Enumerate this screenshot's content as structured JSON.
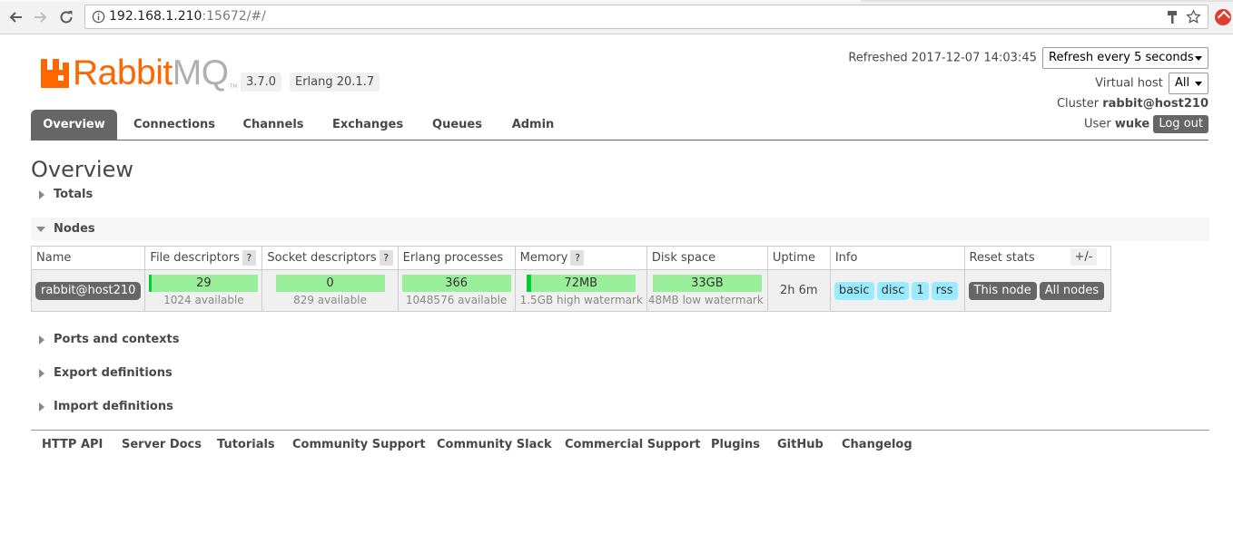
{
  "browser": {
    "url_host": "192.168.1.210",
    "url_rest": ":15672/#/"
  },
  "header": {
    "logo_primary": "Rabbit",
    "logo_secondary": "MQ",
    "logo_tm": "TM",
    "version": "3.7.0",
    "erlang": "Erlang 20.1.7",
    "refreshed_label": "Refreshed 2017-12-07 14:03:45",
    "refresh_select": "Refresh every 5 seconds",
    "vhost_label": "Virtual host",
    "vhost_select": "All",
    "cluster_label": "Cluster",
    "cluster_value": "rabbit@host210",
    "user_label": "User",
    "user_value": "wuke",
    "logout_label": "Log out"
  },
  "tabs": [
    "Overview",
    "Connections",
    "Channels",
    "Exchanges",
    "Queues",
    "Admin"
  ],
  "page_title": "Overview",
  "sections": {
    "totals": "Totals",
    "nodes": "Nodes",
    "ports": "Ports and contexts",
    "export": "Export definitions",
    "import": "Import definitions"
  },
  "nodes_table": {
    "headers": {
      "name": "Name",
      "fd": "File descriptors",
      "sd": "Socket descriptors",
      "ep": "Erlang processes",
      "mem": "Memory",
      "disk": "Disk space",
      "uptime": "Uptime",
      "info": "Info",
      "reset": "Reset stats"
    },
    "help_glyph": "?",
    "plusminus": "+/-",
    "row": {
      "name": "rabbit@host210",
      "fd_value": "29",
      "fd_sub": "1024 available",
      "sd_value": "0",
      "sd_sub": "829 available",
      "ep_value": "366",
      "ep_sub": "1048576 available",
      "mem_value": "72MB",
      "mem_sub": "1.5GB high watermark",
      "disk_value": "33GB",
      "disk_sub": "48MB low watermark",
      "uptime": "2h 6m",
      "info_tags": [
        "basic",
        "disc",
        "1",
        "rss"
      ],
      "reset_this": "This node",
      "reset_all": "All nodes"
    }
  },
  "footer_links": [
    "HTTP API",
    "Server Docs",
    "Tutorials",
    "Community Support",
    "Community Slack",
    "Commercial Support",
    "Plugins",
    "GitHub",
    "Changelog"
  ],
  "colors": {
    "accent": "#ff6600",
    "bar_fill": "#99ee99",
    "bar_edge": "#00cc33",
    "tag": "#99ebff",
    "dark_button": "#666666"
  }
}
